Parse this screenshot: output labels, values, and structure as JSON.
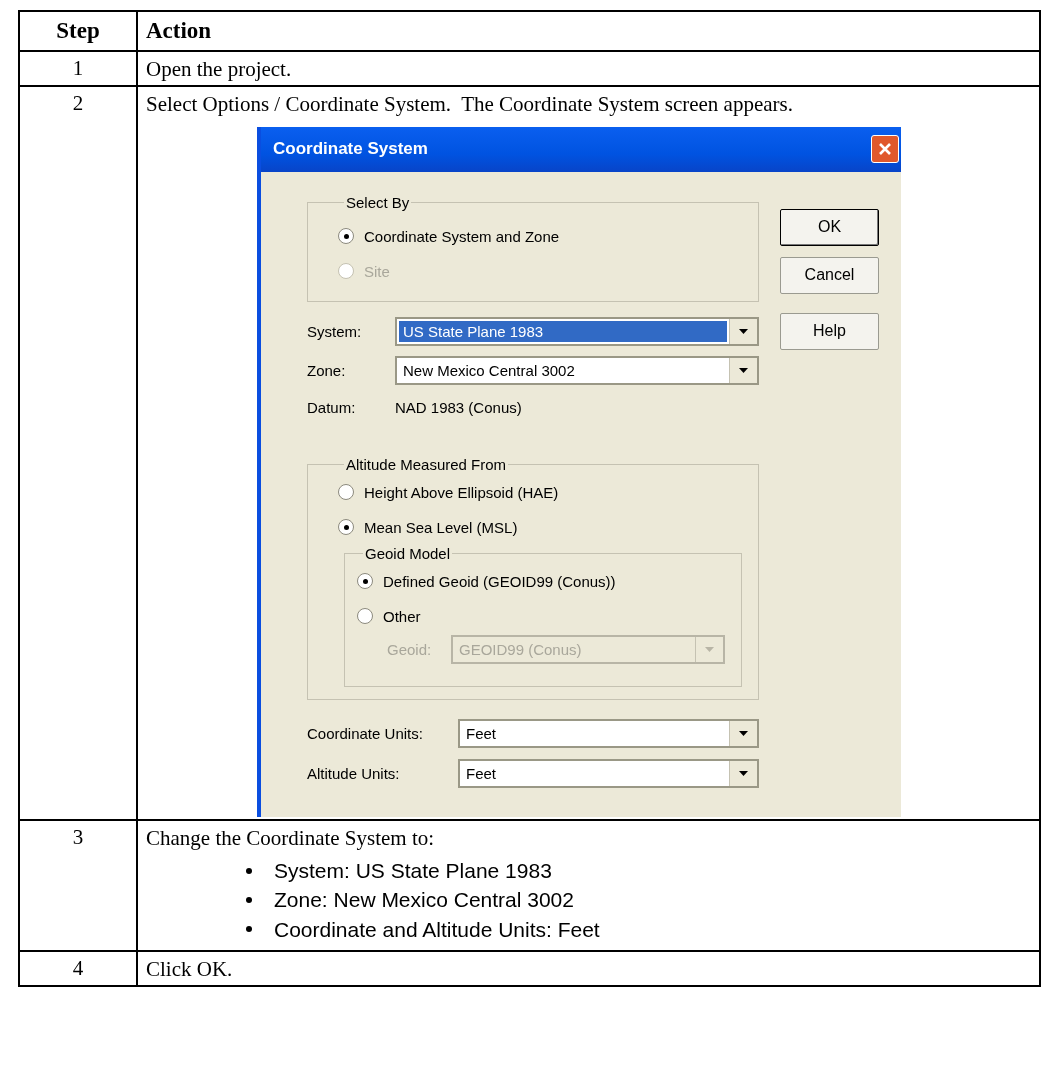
{
  "table": {
    "columns": [
      "Step",
      "Action"
    ],
    "rows": [
      {
        "step": "1",
        "action": "Open the project."
      },
      {
        "step": "2",
        "action": "Select Options / Coordinate System.  The Coordinate System screen appears.",
        "dialog": {
          "title": "Coordinate System",
          "select_by": {
            "label": "Select By",
            "options": [
              {
                "label": "Coordinate System and Zone",
                "selected": true,
                "disabled": false
              },
              {
                "label": "Site",
                "selected": false,
                "disabled": true
              }
            ]
          },
          "buttons": [
            {
              "label": "OK",
              "default": true
            },
            {
              "label": "Cancel",
              "default": false
            },
            {
              "label": "Help",
              "default": false
            }
          ],
          "system": {
            "label": "System:",
            "value": "US State Plane 1983",
            "focused": true
          },
          "zone": {
            "label": "Zone:",
            "value": "New Mexico Central 3002",
            "focused": false
          },
          "datum": {
            "label": "Datum:",
            "value": "NAD 1983 (Conus)"
          },
          "altitude": {
            "label": "Altitude Measured From",
            "options": [
              {
                "label": "Height Above Ellipsoid (HAE)",
                "selected": false,
                "disabled": false
              },
              {
                "label": "Mean Sea Level (MSL)",
                "selected": true,
                "disabled": false
              }
            ],
            "geoid_model": {
              "label": "Geoid Model",
              "options": [
                {
                  "label": "Defined Geoid (GEOID99 (Conus))",
                  "selected": true,
                  "disabled": false
                },
                {
                  "label": "Other",
                  "selected": false,
                  "disabled": false
                }
              ],
              "geoid": {
                "label": "Geoid:",
                "value": "GEOID99 (Conus)",
                "disabled": true
              }
            }
          },
          "units": [
            {
              "label": "Coordinate Units:",
              "value": "Feet"
            },
            {
              "label": "Altitude Units:",
              "value": "Feet"
            }
          ]
        }
      },
      {
        "step": "3",
        "action": "Change the Coordinate System to:",
        "bullets": [
          "System: US State Plane 1983",
          "Zone: New Mexico Central 3002",
          "Coordinate and Altitude Units: Feet"
        ]
      },
      {
        "step": "4",
        "action": "Click OK."
      }
    ]
  }
}
